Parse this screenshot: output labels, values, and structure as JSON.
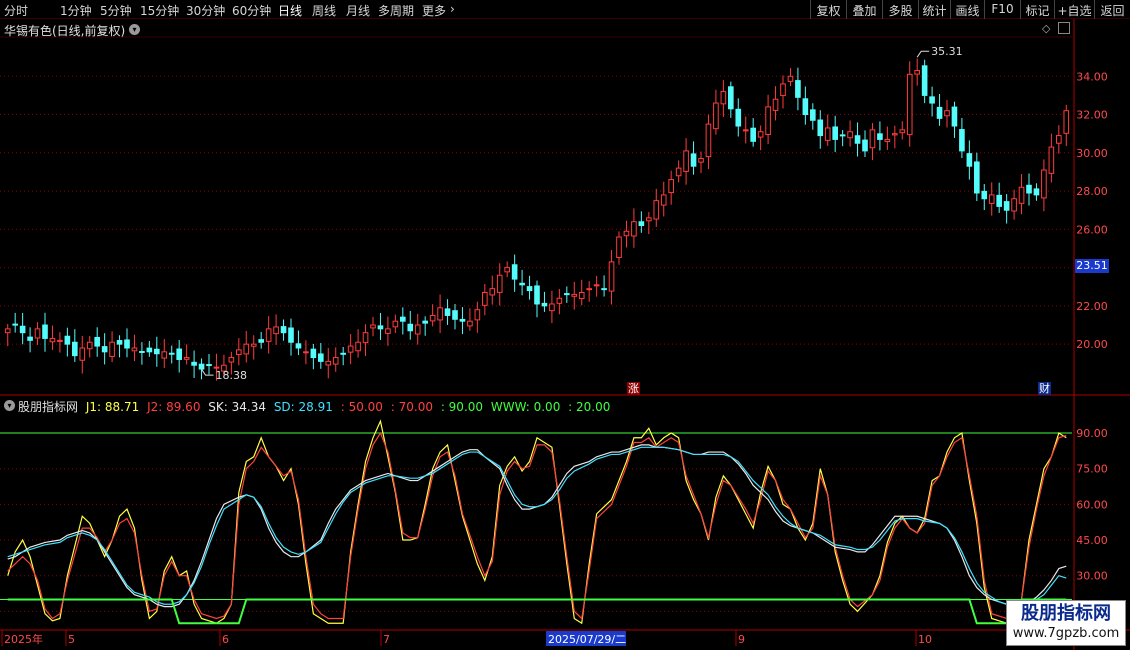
{
  "toolbar": {
    "periods": [
      "分时",
      "1分钟",
      "5分钟",
      "15分钟",
      "30分钟",
      "60分钟",
      "日线",
      "周线",
      "月线",
      "多周期",
      "更多"
    ],
    "active_period": "日线",
    "right_buttons": [
      "复权",
      "叠加",
      "多股",
      "统计",
      "画线",
      "F10",
      "标记",
      "+自选",
      "返回"
    ]
  },
  "main_panel": {
    "title": "华锡有色(日线,前复权)",
    "current_price_tag": "23.51",
    "high_label": "35.31",
    "low_label": "18.38",
    "badge_zhang": "涨",
    "badge_cai": "财"
  },
  "indicator_panel": {
    "name": "股朋指标网",
    "legend": [
      {
        "label": "J1: 88.71",
        "color": "#ffff44"
      },
      {
        "label": "J2: 89.60",
        "color": "#ff4040"
      },
      {
        "label": "SK: 34.34",
        "color": "#e8e8e8"
      },
      {
        "label": "SD: 28.91",
        "color": "#40e0ff"
      },
      {
        "label": ": 50.00",
        "color": "#ff4040"
      },
      {
        "label": ": 70.00",
        "color": "#ff4040"
      },
      {
        "label": ": 90.00",
        "color": "#40ff40"
      },
      {
        "label": "WWW: 0.00",
        "color": "#40ff40"
      },
      {
        "label": ": 20.00",
        "color": "#40ff40"
      }
    ]
  },
  "x_axis": {
    "labels": [
      "2025年",
      "5",
      "6",
      "7",
      "2025/07/29/二",
      "9",
      "10"
    ]
  },
  "watermark": {
    "title": "股朋指标网",
    "url": "www.7gpzb.com"
  },
  "colors": {
    "up": "#ff3c3c",
    "down": "#54fcfc",
    "grid": "#8b0000",
    "axis": "#b00000"
  },
  "chart_data": [
    {
      "type": "candlestick",
      "title": "华锡有色(日线,前复权)",
      "ylim": [
        17.5,
        36.0
      ],
      "y_ticks": [
        20.0,
        22.0,
        24.0,
        26.0,
        28.0,
        30.0,
        32.0,
        34.0
      ],
      "y_tick_labels": [
        "20.00",
        "22.00",
        "24.00",
        "26.00",
        "28.00",
        "30.00",
        "32.00",
        "34.00"
      ],
      "close": [
        20.8,
        21.0,
        20.6,
        20.2,
        20.8,
        20.3,
        20.3,
        20.2,
        20.0,
        19.4,
        19.8,
        20.1,
        19.9,
        19.6,
        20.1,
        20.0,
        19.8,
        19.8,
        19.6,
        19.6,
        19.5,
        19.6,
        19.5,
        19.2,
        19.3,
        18.9,
        18.7,
        18.9,
        18.8,
        18.9,
        19.3,
        19.7,
        20.0,
        20.0,
        20.1,
        20.8,
        20.9,
        20.6,
        20.1,
        19.8,
        19.6,
        19.3,
        19.1,
        19.1,
        19.3,
        19.5,
        19.9,
        20.1,
        20.6,
        21.0,
        20.8,
        20.8,
        21.2,
        21.2,
        20.7,
        21.0,
        21.1,
        21.5,
        21.9,
        21.5,
        21.3,
        21.2,
        21.2,
        21.8,
        22.7,
        22.9,
        23.6,
        24.0,
        23.4,
        23.1,
        22.8,
        22.1,
        22.0,
        22.1,
        22.4,
        22.6,
        22.6,
        22.7,
        22.9,
        23.1,
        22.9,
        24.3,
        25.6,
        25.9,
        26.4,
        26.2,
        26.6,
        27.5,
        27.8,
        28.6,
        29.2,
        30.1,
        29.3,
        29.7,
        31.5,
        32.6,
        33.2,
        32.3,
        31.4,
        31.2,
        30.6,
        31.1,
        32.4,
        32.8,
        33.6,
        34.0,
        32.9,
        32.0,
        31.7,
        30.9,
        31.3,
        30.7,
        30.9,
        31.1,
        30.5,
        30.1,
        31.2,
        30.7,
        30.7,
        31.0,
        31.2,
        34.1,
        34.3,
        33.0,
        32.6,
        31.8,
        32.2,
        31.4,
        30.1,
        29.3,
        27.9,
        27.6,
        27.8,
        27.2,
        27.0,
        27.6,
        28.2,
        27.9,
        27.8,
        29.1,
        30.3,
        30.9,
        32.2
      ]
    },
    {
      "type": "line",
      "title": "股朋指标网",
      "ylim": [
        8.0,
        98.0
      ],
      "y_ticks": [
        15,
        30,
        45,
        60,
        75,
        90
      ],
      "y_tick_labels": [
        "15.00",
        "30.00",
        "45.00",
        "60.00",
        "75.00",
        "90.00"
      ],
      "reference_lines": [
        {
          "value": 90,
          "color": "#40ff40"
        },
        {
          "value": 20,
          "color": "#40ff40"
        }
      ],
      "series": [
        {
          "name": "J1",
          "color": "#ffff44",
          "values": [
            30,
            40,
            45,
            38,
            26,
            14,
            11,
            12,
            30,
            55,
            52,
            45,
            38,
            45,
            55,
            58,
            50,
            28,
            12,
            15,
            32,
            38,
            30,
            32,
            18,
            12,
            10,
            12,
            18,
            65,
            78,
            80,
            88,
            80,
            76,
            70,
            75,
            60,
            35,
            14,
            12,
            10,
            10,
            40,
            60,
            78,
            88,
            95,
            80,
            65,
            45,
            45,
            46,
            60,
            75,
            82,
            85,
            70,
            55,
            35,
            28,
            38,
            68,
            76,
            80,
            74,
            78,
            88,
            86,
            84,
            60,
            35,
            12,
            10,
            35,
            56,
            62,
            70,
            78,
            88,
            88,
            92,
            85,
            88,
            90,
            88,
            70,
            62,
            56,
            45,
            63,
            72,
            68,
            56,
            50,
            65,
            76,
            70,
            60,
            58,
            50,
            45,
            52,
            75,
            64,
            40,
            28,
            18,
            15,
            22,
            30,
            44,
            52,
            55,
            50,
            48,
            54,
            70,
            72,
            82,
            88,
            90,
            70,
            52,
            25,
            12,
            10,
            12,
            20,
            45,
            60,
            75,
            80,
            90,
            88
          ]
        },
        {
          "name": "J2",
          "color": "#ff4040",
          "values": [
            32,
            35,
            38,
            35,
            28,
            16,
            12,
            14,
            28,
            50,
            50,
            46,
            40,
            45,
            52,
            54,
            48,
            30,
            15,
            16,
            30,
            36,
            30,
            30,
            20,
            14,
            12,
            13,
            18,
            60,
            75,
            78,
            84,
            80,
            76,
            72,
            74,
            62,
            38,
            18,
            14,
            12,
            12,
            38,
            58,
            75,
            85,
            90,
            82,
            66,
            48,
            46,
            46,
            58,
            72,
            80,
            82,
            72,
            56,
            38,
            30,
            36,
            64,
            74,
            78,
            75,
            76,
            85,
            85,
            82,
            62,
            38,
            15,
            12,
            32,
            54,
            60,
            68,
            76,
            86,
            86,
            88,
            84,
            86,
            88,
            86,
            72,
            64,
            56,
            46,
            60,
            70,
            68,
            58,
            52,
            62,
            74,
            70,
            62,
            58,
            52,
            46,
            50,
            72,
            64,
            42,
            30,
            20,
            17,
            22,
            28,
            42,
            50,
            54,
            50,
            48,
            52,
            68,
            72,
            80,
            86,
            88,
            72,
            55,
            28,
            14,
            12,
            14,
            20,
            42,
            58,
            72,
            80,
            88,
            89
          ]
        },
        {
          "name": "SK",
          "color": "#e8e8e8",
          "values": [
            37,
            38,
            40,
            42,
            43,
            44,
            45,
            47,
            48,
            49,
            48,
            45,
            40,
            35,
            30,
            25,
            22,
            20,
            18,
            17,
            17,
            18,
            22,
            28,
            36,
            45,
            54,
            60,
            63,
            64,
            63,
            58,
            50,
            44,
            40,
            38,
            38,
            40,
            45,
            52,
            58,
            62,
            66,
            68,
            70,
            71,
            72,
            73,
            72,
            70,
            70,
            72,
            74,
            76,
            78,
            80,
            82,
            83,
            83,
            80,
            75,
            68,
            62,
            58,
            58,
            59,
            60,
            63,
            68,
            73,
            76,
            78,
            80,
            81,
            82,
            82,
            83,
            84,
            85,
            85,
            84,
            84,
            83,
            82,
            81,
            81,
            82,
            82,
            82,
            80,
            77,
            73,
            68,
            62,
            57,
            53,
            51,
            50,
            49,
            48,
            46,
            44,
            42,
            41,
            40,
            40,
            43,
            47,
            51,
            55,
            55,
            55,
            55,
            54,
            52,
            50,
            45,
            38,
            30,
            25,
            22,
            20,
            19,
            18,
            18,
            19,
            21,
            24,
            28,
            33,
            34
          ]
        },
        {
          "name": "SD",
          "color": "#40e0ff",
          "values": [
            38,
            39,
            40,
            41,
            42,
            43,
            44,
            46,
            47,
            48,
            47,
            45,
            41,
            36,
            31,
            26,
            23,
            21,
            19,
            18,
            18,
            19,
            22,
            27,
            34,
            43,
            51,
            58,
            62,
            64,
            63,
            59,
            52,
            46,
            42,
            40,
            39,
            40,
            44,
            50,
            56,
            61,
            65,
            67,
            69,
            70,
            71,
            72,
            72,
            71,
            71,
            72,
            73,
            75,
            77,
            79,
            81,
            82,
            82,
            80,
            76,
            70,
            64,
            60,
            59,
            59,
            60,
            62,
            66,
            71,
            74,
            77,
            79,
            80,
            81,
            81,
            82,
            83,
            84,
            84,
            84,
            84,
            83,
            82,
            81,
            81,
            81,
            81,
            81,
            80,
            78,
            74,
            70,
            64,
            59,
            55,
            52,
            50,
            49,
            48,
            47,
            45,
            43,
            42,
            41,
            41,
            42,
            45,
            49,
            53,
            54,
            54,
            54,
            53,
            52,
            50,
            46,
            40,
            33,
            27,
            23,
            21,
            19,
            18,
            18,
            18,
            20,
            22,
            26,
            30,
            29
          ]
        },
        {
          "name": "WWW",
          "color": "#40ff40",
          "values": [
            20,
            20,
            20,
            20,
            20,
            20,
            20,
            20,
            20,
            20,
            20,
            20,
            20,
            20,
            20,
            20,
            20,
            20,
            20,
            20,
            20,
            20,
            10,
            10,
            10,
            10,
            10,
            10,
            10,
            10,
            20,
            20,
            20,
            20,
            20,
            20,
            20,
            20,
            20,
            20,
            20,
            20,
            20,
            20,
            20,
            20,
            20,
            20,
            20,
            20,
            20,
            20,
            20,
            20,
            20,
            20,
            20,
            20,
            20,
            20,
            20,
            20,
            20,
            20,
            20,
            20,
            20,
            20,
            20,
            20,
            20,
            20,
            20,
            20,
            20,
            20,
            20,
            20,
            20,
            20,
            20,
            20,
            20,
            20,
            20,
            20,
            20,
            20,
            20,
            20,
            20,
            20,
            20,
            20,
            20,
            20,
            20,
            20,
            20,
            20,
            20,
            20,
            20,
            20,
            20,
            20,
            20,
            20,
            20,
            20,
            20,
            20,
            20,
            20,
            20,
            20,
            20,
            20,
            20,
            20,
            20,
            20,
            20,
            10,
            10,
            10,
            10,
            12,
            20,
            20,
            20,
            20,
            20,
            20,
            20
          ]
        }
      ]
    }
  ]
}
